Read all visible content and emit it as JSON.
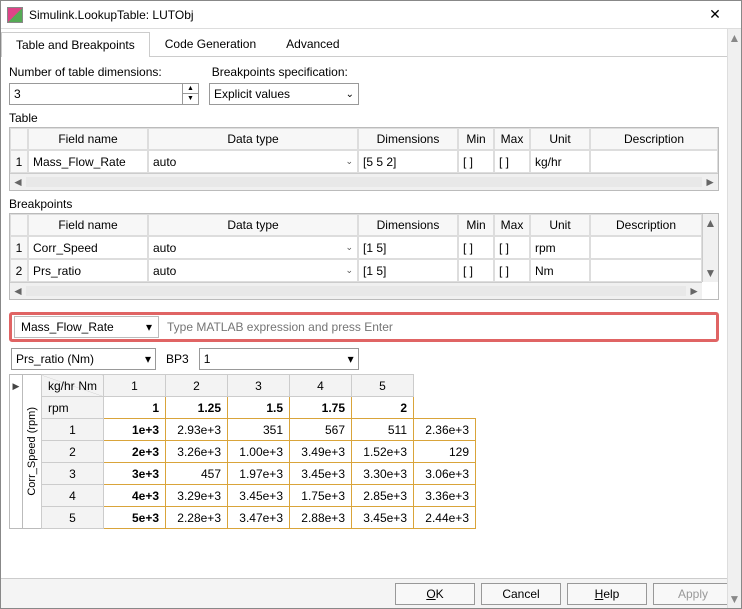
{
  "window": {
    "title": "Simulink.LookupTable: LUTObj",
    "close": "✕"
  },
  "tabs": [
    "Table and Breakpoints",
    "Code Generation",
    "Advanced"
  ],
  "active_tab": 0,
  "dims": {
    "label": "Number of table dimensions:",
    "value": "3"
  },
  "bp_spec": {
    "label": "Breakpoints specification:",
    "value": "Explicit values"
  },
  "table_section": {
    "label": "Table",
    "headers": [
      "",
      "Field name",
      "Data type",
      "Dimensions",
      "Min",
      "Max",
      "Unit",
      "Description"
    ],
    "rows": [
      {
        "n": "1",
        "field": "Mass_Flow_Rate",
        "dtype": "auto",
        "dims": "[5 5 2]",
        "min": "[ ]",
        "max": "[ ]",
        "unit": "kg/hr",
        "desc": ""
      }
    ]
  },
  "bp_section": {
    "label": "Breakpoints",
    "headers": [
      "",
      "Field name",
      "Data type",
      "Dimensions",
      "Min",
      "Max",
      "Unit",
      "Description"
    ],
    "rows": [
      {
        "n": "1",
        "field": "Corr_Speed",
        "dtype": "auto",
        "dims": "[1 5]",
        "min": "[ ]",
        "max": "[ ]",
        "unit": "rpm",
        "desc": ""
      },
      {
        "n": "2",
        "field": "Prs_ratio",
        "dtype": "auto",
        "dims": "[1 5]",
        "min": "[ ]",
        "max": "[ ]",
        "unit": "Nm",
        "desc": ""
      }
    ]
  },
  "expr": {
    "selector": "Mass_Flow_Rate",
    "placeholder": "Type MATLAB expression and press Enter"
  },
  "viewer_ctrl": {
    "dim2": "Prs_ratio (Nm)",
    "bp3_label": "BP3",
    "bp3_value": "1"
  },
  "viewer": {
    "side_label": "Corr_Speed (rpm)",
    "corner_top": "kg/hr",
    "corner_right": "Nm",
    "corner_bottom": "rpm",
    "col_idx": [
      "1",
      "2",
      "3",
      "4",
      "5"
    ],
    "col_bp": [
      "1",
      "1.25",
      "1.5",
      "1.75",
      "2"
    ],
    "rows": [
      {
        "idx": "1",
        "bp": "1e+3",
        "vals": [
          "2.93e+3",
          "351",
          "567",
          "511",
          "2.36e+3"
        ]
      },
      {
        "idx": "2",
        "bp": "2e+3",
        "vals": [
          "3.26e+3",
          "1.00e+3",
          "3.49e+3",
          "1.52e+3",
          "129"
        ]
      },
      {
        "idx": "3",
        "bp": "3e+3",
        "vals": [
          "457",
          "1.97e+3",
          "3.45e+3",
          "3.30e+3",
          "3.06e+3"
        ]
      },
      {
        "idx": "4",
        "bp": "4e+3",
        "vals": [
          "3.29e+3",
          "3.45e+3",
          "1.75e+3",
          "2.85e+3",
          "3.36e+3"
        ]
      },
      {
        "idx": "5",
        "bp": "5e+3",
        "vals": [
          "2.28e+3",
          "3.47e+3",
          "2.88e+3",
          "3.45e+3",
          "2.44e+3"
        ]
      }
    ]
  },
  "buttons": {
    "ok": "OK",
    "cancel": "Cancel",
    "help": "Help",
    "apply": "Apply"
  },
  "chart_data": {
    "type": "table",
    "title": "Mass_Flow_Rate lookup table slice (BP3 = 1)",
    "xlabel": "Prs_ratio (Nm)",
    "ylabel": "Corr_Speed (rpm)",
    "x_breakpoints": [
      1,
      1.25,
      1.5,
      1.75,
      2
    ],
    "y_breakpoints": [
      1000,
      2000,
      3000,
      4000,
      5000
    ],
    "unit": "kg/hr",
    "values": [
      [
        2930,
        351,
        567,
        511,
        2360
      ],
      [
        3260,
        1000,
        3490,
        1520,
        129
      ],
      [
        457,
        1970,
        3450,
        3300,
        3060
      ],
      [
        3290,
        3450,
        1750,
        2850,
        3360
      ],
      [
        2280,
        3470,
        2880,
        3450,
        2440
      ]
    ]
  }
}
